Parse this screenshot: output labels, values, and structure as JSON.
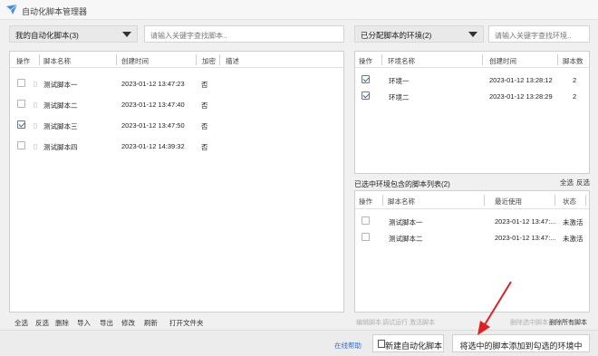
{
  "window": {
    "title": "自动化脚本管理器"
  },
  "left": {
    "dropdown": "我的自动化脚本(3)",
    "search_placeholder": "请输入关键字查找脚本..",
    "columns": [
      "操作",
      "脚本名称",
      "创建时间",
      "加密",
      "描述"
    ],
    "rows": [
      {
        "name": "测试脚本一",
        "time": "2023-01-12 13:47:23",
        "enc": "否",
        "checked": false
      },
      {
        "name": "测试脚本二",
        "time": "2023-01-12 13:47:40",
        "enc": "否",
        "checked": false
      },
      {
        "name": "测试脚本三",
        "time": "2023-01-12 13:47:50",
        "enc": "否",
        "checked": true
      },
      {
        "name": "测试脚本四",
        "time": "2023-01-12 14:39:32",
        "enc": "否",
        "checked": false
      }
    ],
    "actions": [
      "全选",
      "反选",
      "删除",
      "导入",
      "导出",
      "修改",
      "刷新",
      "打开文件夹"
    ]
  },
  "right": {
    "dropdown": "已分配脚本的环境(2)",
    "search_placeholder": "请输入关键字查找环境..",
    "env_columns": [
      "操作",
      "环境名称",
      "创建时间",
      "脚本数"
    ],
    "envs": [
      {
        "name": "环境一",
        "time": "2023-01-12 13:28:12",
        "count": "2",
        "checked": true
      },
      {
        "name": "环境二",
        "time": "2023-01-12 13:28:29",
        "count": "2",
        "checked": true
      }
    ],
    "selected_label": "已选中环境包含的脚本列表(2)",
    "select_all": "全选",
    "invert": "反选",
    "script_columns": [
      "操作",
      "脚本名称",
      "最近使用",
      "状态"
    ],
    "scripts": [
      {
        "name": "测试脚本一",
        "time": "2023-01-12 13:47:...",
        "status": "未激活"
      },
      {
        "name": "测试脚本二",
        "time": "2023-01-12 13:47:...",
        "status": "未激活"
      }
    ],
    "actions_dim": [
      "编辑脚本",
      "调试运行",
      "激活脚本"
    ],
    "remove_selected": "删除选中脚本",
    "remove_all": "删除所有脚本"
  },
  "footer": {
    "help": "在线帮助",
    "new_script": "新建自动化脚本",
    "add_to_env": "将选中的脚本添加到勾选的环境中"
  },
  "colors": {
    "accent": "#2f5fb8",
    "arrow": "#e02020",
    "help_link": "#3a6fc8"
  }
}
